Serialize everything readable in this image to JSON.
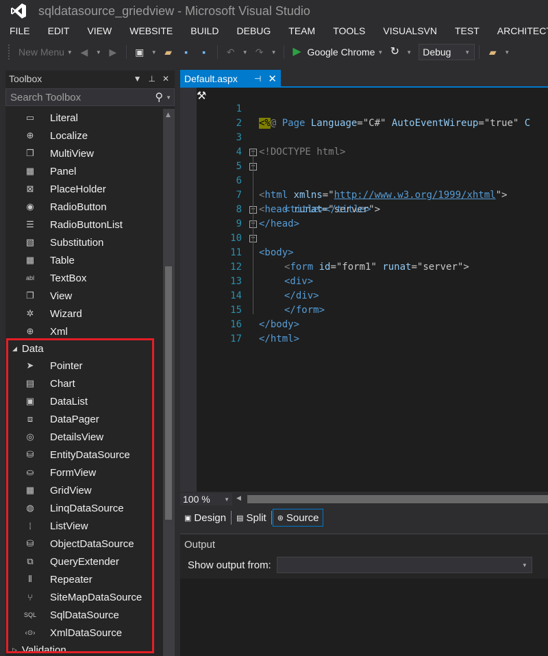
{
  "window": {
    "title": "sqldatasource_griedview - Microsoft Visual Studio",
    "logo_icon": "visual-studio-logo"
  },
  "menu": [
    "FILE",
    "EDIT",
    "VIEW",
    "WEBSITE",
    "BUILD",
    "DEBUG",
    "TEAM",
    "TOOLS",
    "VISUALSVN",
    "TEST",
    "ARCHITECTURE"
  ],
  "toolbar": {
    "new_menu": "New Menu",
    "browser": "Google Chrome",
    "config": "Debug"
  },
  "toolbox": {
    "title": "Toolbox",
    "search_placeholder": "Search Toolbox",
    "standard_items": [
      {
        "label": "Literal",
        "icon": "literal-icon"
      },
      {
        "label": "Localize",
        "icon": "localize-icon"
      },
      {
        "label": "MultiView",
        "icon": "multiview-icon"
      },
      {
        "label": "Panel",
        "icon": "panel-icon"
      },
      {
        "label": "PlaceHolder",
        "icon": "placeholder-icon"
      },
      {
        "label": "RadioButton",
        "icon": "radiobutton-icon"
      },
      {
        "label": "RadioButtonList",
        "icon": "radiobuttonlist-icon"
      },
      {
        "label": "Substitution",
        "icon": "substitution-icon"
      },
      {
        "label": "Table",
        "icon": "table-icon"
      },
      {
        "label": "TextBox",
        "icon": "textbox-icon"
      },
      {
        "label": "View",
        "icon": "view-icon"
      },
      {
        "label": "Wizard",
        "icon": "wizard-icon"
      },
      {
        "label": "Xml",
        "icon": "xml-icon"
      }
    ],
    "data_category": "Data",
    "data_items": [
      {
        "label": "Pointer",
        "icon": "pointer-icon"
      },
      {
        "label": "Chart",
        "icon": "chart-icon"
      },
      {
        "label": "DataList",
        "icon": "datalist-icon"
      },
      {
        "label": "DataPager",
        "icon": "datapager-icon"
      },
      {
        "label": "DetailsView",
        "icon": "detailsview-icon"
      },
      {
        "label": "EntityDataSource",
        "icon": "entitydatasource-icon"
      },
      {
        "label": "FormView",
        "icon": "formview-icon"
      },
      {
        "label": "GridView",
        "icon": "gridview-icon"
      },
      {
        "label": "LinqDataSource",
        "icon": "linqdatasource-icon"
      },
      {
        "label": "ListView",
        "icon": "listview-icon"
      },
      {
        "label": "ObjectDataSource",
        "icon": "objectdatasource-icon"
      },
      {
        "label": "QueryExtender",
        "icon": "queryextender-icon"
      },
      {
        "label": "Repeater",
        "icon": "repeater-icon"
      },
      {
        "label": "SiteMapDataSource",
        "icon": "sitemapdatasource-icon"
      },
      {
        "label": "SqlDataSource",
        "icon": "sqldatasource-icon"
      },
      {
        "label": "XmlDataSource",
        "icon": "xmldatasource-icon"
      }
    ],
    "next_category": "Validation",
    "highlight_color": "#e51e25"
  },
  "editor": {
    "tab_label": "Default.aspx",
    "line_numbers": [
      "1",
      "2",
      "3",
      "4",
      "5",
      "6",
      "7",
      "8",
      "9",
      "10",
      "11",
      "12",
      "13",
      "14",
      "15",
      "16",
      "17"
    ],
    "code": {
      "l1_asp": "<%",
      "l1_rest_a": "@ ",
      "l1_page": "Page",
      "l1_lang_attr": " Language",
      "l1_lang_val": "=\"C#\"",
      "l1_auto_attr": " AutoEventWireup",
      "l1_auto_val": "=\"true\"",
      "l1_tail": " C",
      "l3": "<!DOCTYPE html>",
      "l5_a": "<",
      "l5_tag": "html",
      "l5_attr": " xmlns",
      "l5_eq": "=\"",
      "l5_url": "http://www.w3.org/1999/xhtml",
      "l5_end": "\">",
      "l6_tag": "head",
      "l6_attr": " runat",
      "l6_val": "=\"server\">",
      "l7": "<title></title>",
      "l8": "</head>",
      "l9": "<body>",
      "l10_tag": "form",
      "l10_attr1": " id",
      "l10_val1": "=\"form1\"",
      "l10_attr2": " runat",
      "l10_val2": "=\"server\">",
      "l11": "<div>",
      "l13": "</div>",
      "l14": "</form>",
      "l15": "</body>",
      "l16": "</html>"
    },
    "zoom": "100 %",
    "views": [
      "Design",
      "Split",
      "Source"
    ],
    "active_view": "Source"
  },
  "output": {
    "title": "Output",
    "show_from_label": "Show output from:"
  }
}
